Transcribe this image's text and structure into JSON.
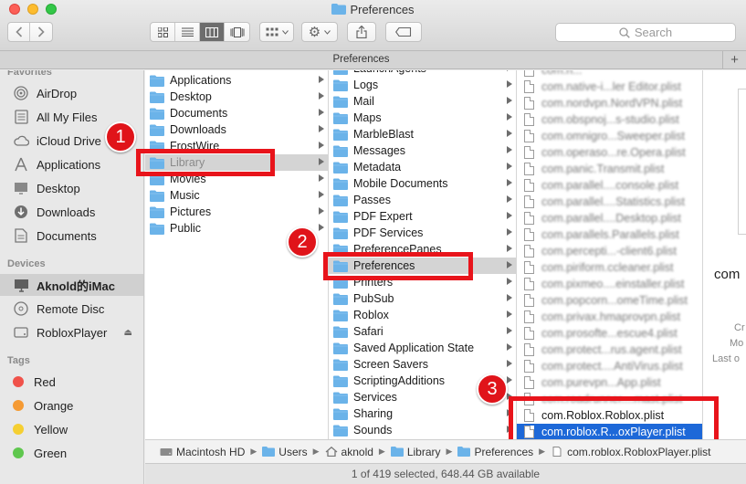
{
  "window": {
    "title": "Preferences"
  },
  "toolbar": {
    "back_icon": "chevron-left-icon",
    "forward_icon": "chevron-right-icon",
    "search_placeholder": "Search"
  },
  "tab": {
    "label": "Preferences"
  },
  "sidebar": {
    "favorites_header": "Favorites",
    "favorites": [
      {
        "label": "AirDrop",
        "icon": "airdrop-icon"
      },
      {
        "label": "All My Files",
        "icon": "all-files-icon"
      },
      {
        "label": "iCloud Drive",
        "icon": "cloud-icon"
      },
      {
        "label": "Applications",
        "icon": "applications-icon"
      },
      {
        "label": "Desktop",
        "icon": "desktop-icon"
      },
      {
        "label": "Downloads",
        "icon": "downloads-icon"
      },
      {
        "label": "Documents",
        "icon": "documents-icon"
      }
    ],
    "devices_header": "Devices",
    "devices": [
      {
        "label": "Aknold的iMac",
        "icon": "imac-icon"
      },
      {
        "label": "Remote Disc",
        "icon": "disc-icon"
      },
      {
        "label": "RobloxPlayer",
        "icon": "disk-icon"
      }
    ],
    "tags_header": "Tags",
    "tags": [
      {
        "label": "Red",
        "color": "#f0524a"
      },
      {
        "label": "Orange",
        "color": "#f59a33"
      },
      {
        "label": "Yellow",
        "color": "#f5cf32"
      },
      {
        "label": "Green",
        "color": "#5fc74e"
      }
    ]
  },
  "column1": [
    "Applications",
    "Desktop",
    "Documents",
    "Downloads",
    "FrostWire",
    "Library",
    "Movies",
    "Music",
    "Pictures",
    "Public"
  ],
  "column2": [
    "LaunchAgents",
    "Logs",
    "Mail",
    "Maps",
    "MarbleBlast",
    "Messages",
    "Metadata",
    "Mobile Documents",
    "Passes",
    "PDF Expert",
    "PDF Services",
    "PreferencePanes",
    "Preferences",
    "Printers",
    "PubSub",
    "Roblox",
    "Safari",
    "Saved Application State",
    "Screen Savers",
    "ScriptingAdditions",
    "Services",
    "Sharing",
    "Sounds"
  ],
  "column3": [
    "com.n...",
    "com.native-i...ler Editor.plist",
    "com.nordvpn.NordVPN.plist",
    "com.obspnoj...s-studio.plist",
    "com.omnigro...Sweeper.plist",
    "com.operaso...re.Opera.plist",
    "com.panic.Transmit.plist",
    "com.parallel....console.plist",
    "com.parallel....Statistics.plist",
    "com.parallel....Desktop.plist",
    "com.parallels.Parallels.plist",
    "com.percepti...-client6.plist",
    "com.piriform.ccleaner.plist",
    "com.pixmeo....einstaller.plist",
    "com.popcorn...omeTime.plist",
    "com.privax.hmaprovpn.plist",
    "com.prosofte...escue4.plist",
    "com.protect...rus.agent.plist",
    "com.protect....AntiVirus.plist",
    "com.purevpn...App.plist",
    "com.roadrunner....mast.plist",
    "com.Roblox.Roblox.plist",
    "com.roblox.R...oxPlayer.plist"
  ],
  "preview": {
    "line1": "com",
    "line2": "Cr",
    "line3": "Mo",
    "line4": "Last o"
  },
  "annotations": {
    "badge1": "1",
    "badge2": "2",
    "badge3": "3"
  },
  "pathbar": [
    {
      "label": "Macintosh HD",
      "icon": "hard-drive-icon"
    },
    {
      "label": "Users",
      "icon": "folder-icon"
    },
    {
      "label": "aknold",
      "icon": "home-icon"
    },
    {
      "label": "Library",
      "icon": "folder-icon"
    },
    {
      "label": "Preferences",
      "icon": "folder-icon"
    },
    {
      "label": "com.roblox.RobloxPlayer.plist",
      "icon": "document-icon"
    }
  ],
  "status": {
    "text": "1 of 419 selected, 648.44 GB available"
  },
  "colors": {
    "selection_blue": "#1d68d8",
    "highlight_red": "#e8141b",
    "folder_blue": "#6bb3e9"
  }
}
